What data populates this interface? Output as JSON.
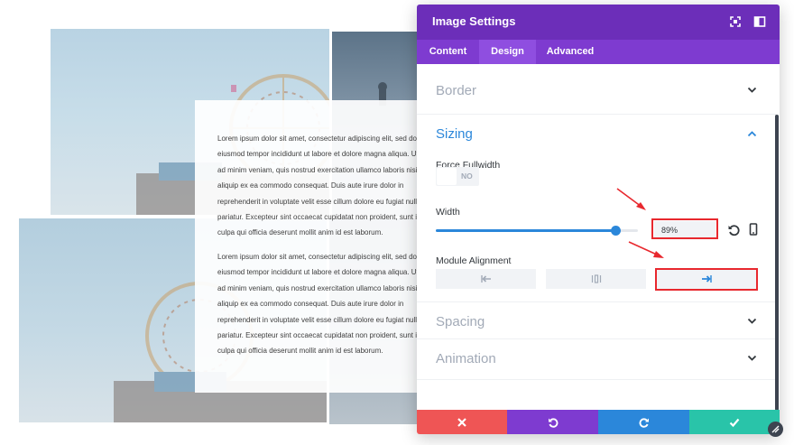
{
  "colors": {
    "header_bg": "#6c2eb9",
    "tabs_bg": "#7e3bd0",
    "active_tab_bg": "#8f4ee0",
    "accent_blue": "#2b87da",
    "discard_red": "#ef5555",
    "undo_purple": "#7e3bd0",
    "redo_blue": "#2b87da",
    "save_green": "#29c4a9",
    "highlight_red": "#e8282e"
  },
  "background": {
    "lorem_block_1": "Lorem ipsum dolor sit amet, consectetur adipiscing elit, sed do eiusmod tempor incididunt ut labore et dolore magna aliqua. Ut enim ad minim veniam, quis nostrud exercitation ullamco laboris nisi ut aliquip ex ea commodo consequat. Duis aute irure dolor in reprehenderit in voluptate velit esse cillum dolore eu fugiat nulla pariatur. Excepteur sint occaecat cupidatat non proident, sunt in culpa qui officia deserunt mollit anim id est laborum.",
    "lorem_block_2": "Lorem ipsum dolor sit amet, consectetur adipiscing elit, sed do eiusmod tempor incididunt ut labore et dolore magna aliqua. Ut enim ad minim veniam, quis nostrud exercitation ullamco laboris nisi ut aliquip ex ea commodo consequat. Duis aute irure dolor in reprehenderit in voluptate velit esse cillum dolore eu fugiat nulla pariatur. Excepteur sint occaecat cupidatat non proident, sunt in culpa qui officia deserunt mollit anim id est laborum."
  },
  "panel": {
    "title": "Image Settings",
    "header_icons": [
      "expand-icon",
      "sidebar-layout-icon"
    ],
    "tabs": [
      {
        "label": "Content",
        "active": false
      },
      {
        "label": "Design",
        "active": true
      },
      {
        "label": "Advanced",
        "active": false
      }
    ],
    "sections": {
      "border": {
        "label": "Border",
        "expanded": false
      },
      "sizing": {
        "label": "Sizing",
        "expanded": true,
        "force_fullwidth": {
          "label": "Force Fullwidth",
          "value": "NO"
        },
        "width": {
          "label": "Width",
          "value": "89%",
          "slider_fraction": 0.89
        },
        "module_alignment": {
          "label": "Module Alignment",
          "options": [
            "align-left-icon",
            "align-center-icon",
            "align-right-icon"
          ],
          "selected": "align-right-icon"
        }
      },
      "spacing": {
        "label": "Spacing",
        "expanded": false
      },
      "animation": {
        "label": "Animation",
        "expanded": false
      }
    },
    "footer_buttons": [
      "close-icon",
      "undo-icon",
      "redo-icon",
      "check-icon"
    ]
  }
}
